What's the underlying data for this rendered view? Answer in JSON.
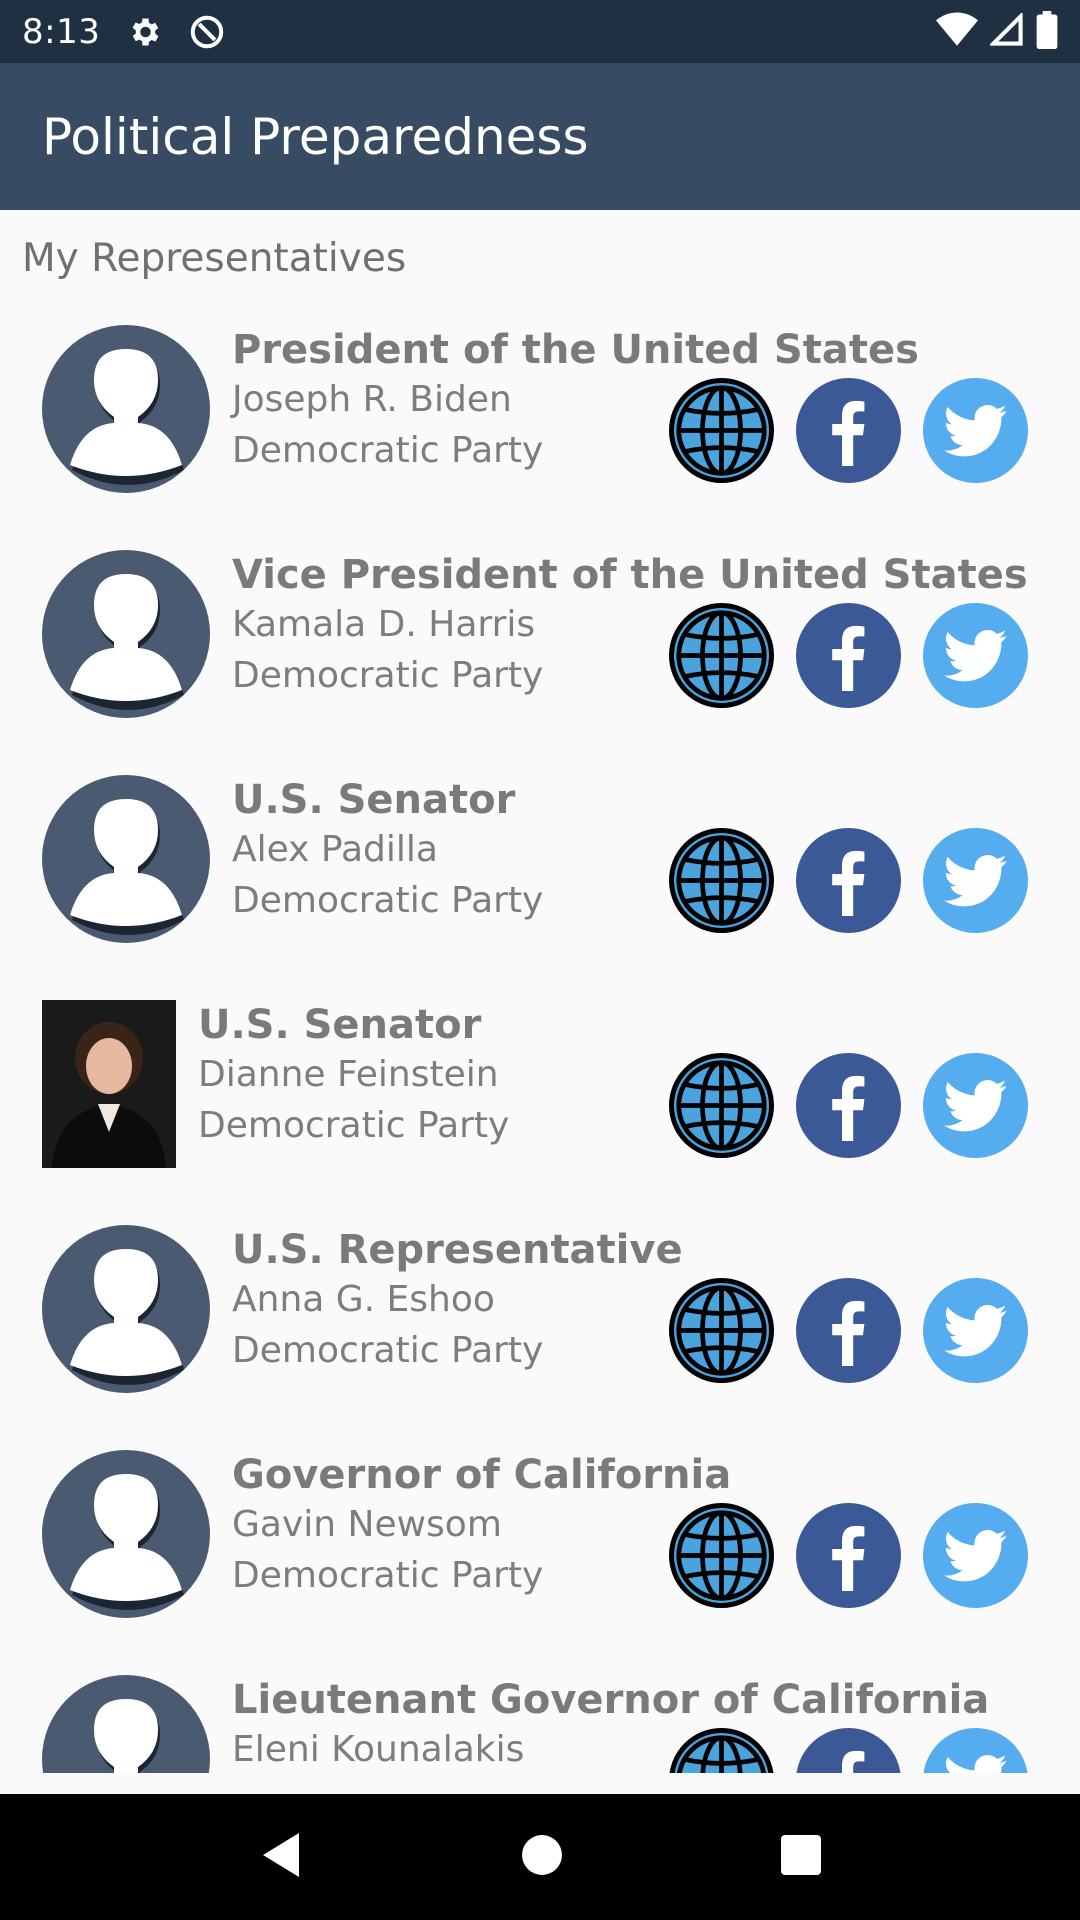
{
  "status_bar": {
    "time": "8:13",
    "left_icons": [
      "settings-icon",
      "data-saver-icon"
    ],
    "right_icons": [
      "wifi-icon",
      "cell-signal-icon",
      "battery-icon"
    ]
  },
  "app_bar": {
    "title": "Political Preparedness"
  },
  "section_title": "My Representatives",
  "representatives": [
    {
      "office": "President of the United States",
      "name": "Joseph R. Biden",
      "party": "Democratic Party",
      "photo": "default-avatar"
    },
    {
      "office": "Vice President of the United States",
      "name": "Kamala D. Harris",
      "party": "Democratic Party",
      "photo": "default-avatar"
    },
    {
      "office": "U.S. Senator",
      "name": "Alex Padilla",
      "party": "Democratic Party",
      "photo": "default-avatar"
    },
    {
      "office": "U.S. Senator",
      "name": "Dianne Feinstein",
      "party": "Democratic Party",
      "photo": "portrait-photo"
    },
    {
      "office": "U.S. Representative",
      "name": "Anna G. Eshoo",
      "party": "Democratic Party",
      "photo": "default-avatar"
    },
    {
      "office": "Governor of California",
      "name": "Gavin Newsom",
      "party": "Democratic Party",
      "photo": "default-avatar"
    },
    {
      "office": "Lieutenant Governor of California",
      "name": "Eleni Kounalakis",
      "party": "",
      "photo": "default-avatar"
    }
  ],
  "link_icons": [
    "www-icon",
    "facebook-icon",
    "twitter-icon"
  ],
  "colors": {
    "status_bar": "#1f3043",
    "app_bar": "#374b62",
    "avatar": "#4a5a70",
    "web_globe": "#4aa3dc",
    "facebook": "#3b5897",
    "twitter": "#55acee"
  },
  "nav_bar": {
    "buttons": [
      "back-button",
      "home-button",
      "recents-button"
    ]
  }
}
